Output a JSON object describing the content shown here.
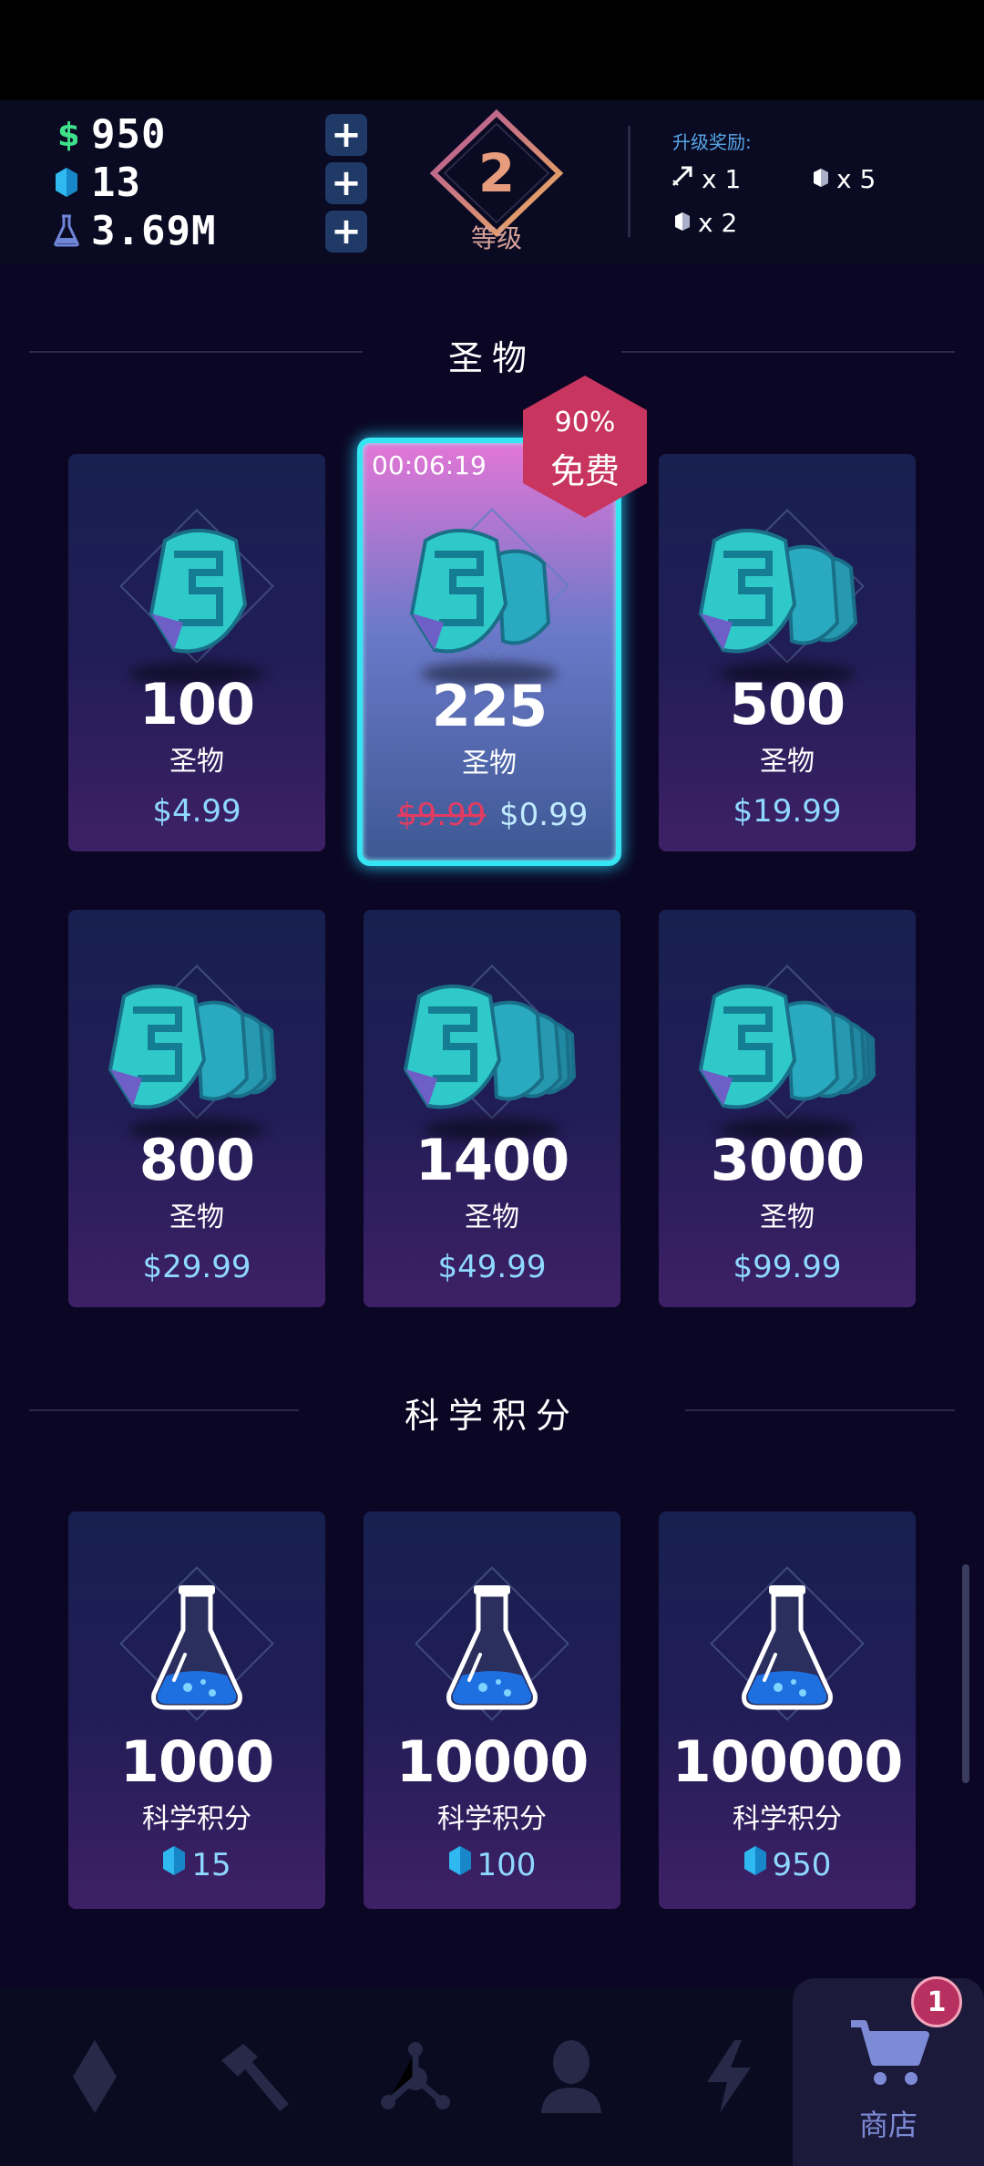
{
  "resources": {
    "money": "950",
    "gems": "13",
    "science": "3.69M"
  },
  "level": {
    "number": "2",
    "label": "等级"
  },
  "rewards": {
    "title": "升级奖励:",
    "items": [
      {
        "icon": "arrow-icon",
        "text": "x 1"
      },
      {
        "icon": "gem-icon",
        "text": "x 5"
      },
      {
        "icon": "gem-icon",
        "text": "x 2"
      }
    ]
  },
  "relics": {
    "title": "圣物",
    "cards": [
      {
        "qty": "100",
        "unit": "圣物",
        "price": "$4.99"
      },
      {
        "qty": "225",
        "unit": "圣物",
        "timer": "00:06:19",
        "old_price": "$9.99",
        "price": "$0.99"
      },
      {
        "qty": "500",
        "unit": "圣物",
        "price": "$19.99"
      },
      {
        "qty": "800",
        "unit": "圣物",
        "price": "$29.99"
      },
      {
        "qty": "1400",
        "unit": "圣物",
        "price": "$49.99"
      },
      {
        "qty": "3000",
        "unit": "圣物",
        "price": "$99.99"
      }
    ],
    "promo": {
      "percent": "90%",
      "label": "免费"
    }
  },
  "science": {
    "title": "科学积分",
    "cards": [
      {
        "qty": "1000",
        "unit": "科学积分",
        "cost": "15"
      },
      {
        "qty": "10000",
        "unit": "科学积分",
        "cost": "100"
      },
      {
        "qty": "100000",
        "unit": "科学积分",
        "cost": "950"
      }
    ]
  },
  "nav": {
    "items": [
      "diamond-icon",
      "hammer-icon",
      "network-icon",
      "person-icon",
      "lightning-icon",
      "cart-icon"
    ],
    "shop_label": "商店",
    "notification_count": "1"
  },
  "colors": {
    "accent_cyan": "#35e5f2",
    "price_blue": "#8fd8ff",
    "strike_red": "#e23c62",
    "badge_red": "#c8355f",
    "money_green": "#3ee08a"
  }
}
